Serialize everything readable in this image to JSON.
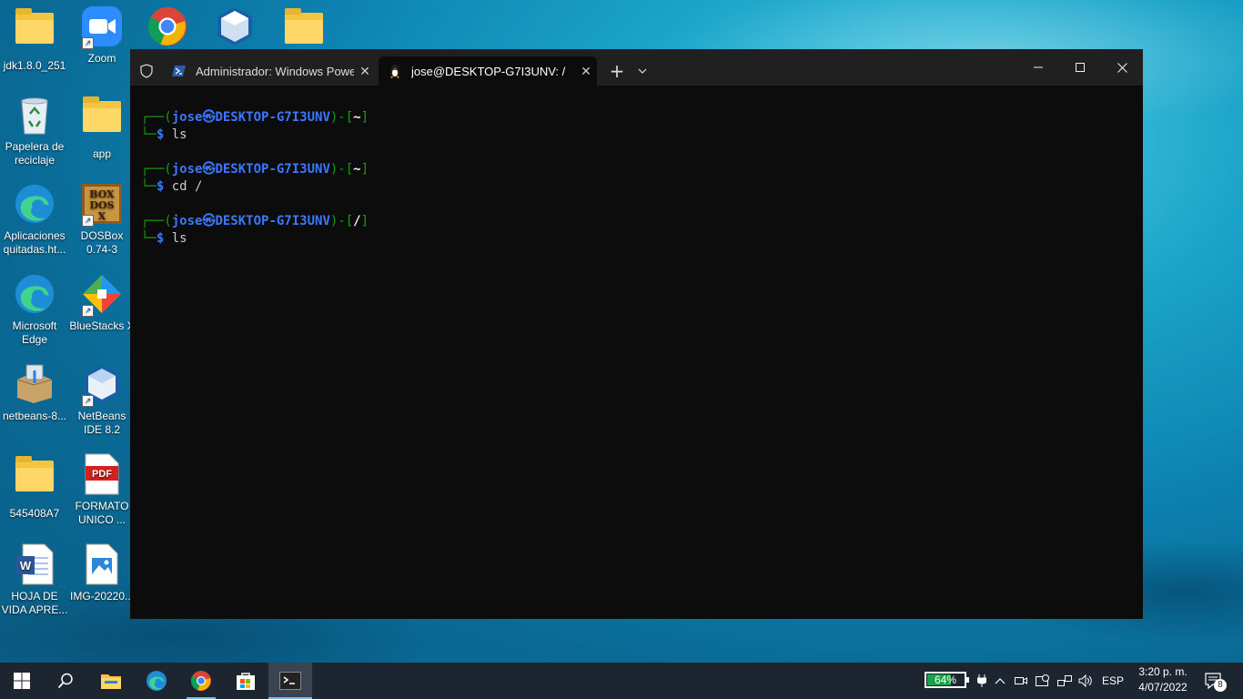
{
  "desktop": {
    "icons": [
      {
        "label": "jdk1.8.0_251",
        "icon": "folder-icon"
      },
      {
        "label": "Zoom",
        "icon": "zoom-icon"
      },
      {
        "label": "Papelera de reciclaje",
        "icon": "recycle-bin-icon"
      },
      {
        "label": "app",
        "icon": "folder-icon"
      },
      {
        "label": "Aplicaciones quitadas.ht...",
        "icon": "edge-icon"
      },
      {
        "label": "DOSBox 0.74-3",
        "icon": "dosbox-icon"
      },
      {
        "label": "Microsoft Edge",
        "icon": "edge-icon"
      },
      {
        "label": "BlueStacks X",
        "icon": "bluestacks-icon"
      },
      {
        "label": "netbeans-8...",
        "icon": "installer-icon"
      },
      {
        "label": "NetBeans IDE 8.2",
        "icon": "netbeans-icon"
      },
      {
        "label": "545408A7",
        "icon": "folder-icon"
      },
      {
        "label": "FORMATO UNICO ...",
        "icon": "pdf-icon"
      },
      {
        "label": "HOJA DE VIDA APRE...",
        "icon": "word-icon"
      },
      {
        "label": "IMG-20220...",
        "icon": "image-icon"
      }
    ],
    "pdf_badge": "PDF",
    "dosbox_badge": "BOX DOS X"
  },
  "terminal": {
    "tabs": [
      {
        "label": "Administrador: Windows Power",
        "icon": "powershell-icon"
      },
      {
        "label": "jose@DESKTOP-G7I3UNV: /",
        "icon": "linux-penguin-icon"
      }
    ],
    "new_tab_glyph": "+",
    "dropdown_glyph": "⌵",
    "close_glyph": "✕",
    "prompts": [
      {
        "user": "jose",
        "host": "DESKTOP-G7I3UNV",
        "dir": "~",
        "cmd": "ls"
      },
      {
        "user": "jose",
        "host": "DESKTOP-G7I3UNV",
        "dir": "~",
        "cmd": "cd /"
      },
      {
        "user": "jose",
        "host": "DESKTOP-G7I3UNV",
        "dir": "/",
        "cmd": "ls"
      }
    ],
    "colors": {
      "prompt_line": "#13a10e",
      "user_host": "#3b78ff",
      "background": "#0c0c0c"
    }
  },
  "taskbar": {
    "battery_percent": 64,
    "battery_label": "64%",
    "language": "ESP",
    "time": "3:20 p. m.",
    "date": "4/07/2022",
    "notification_count": "8"
  }
}
